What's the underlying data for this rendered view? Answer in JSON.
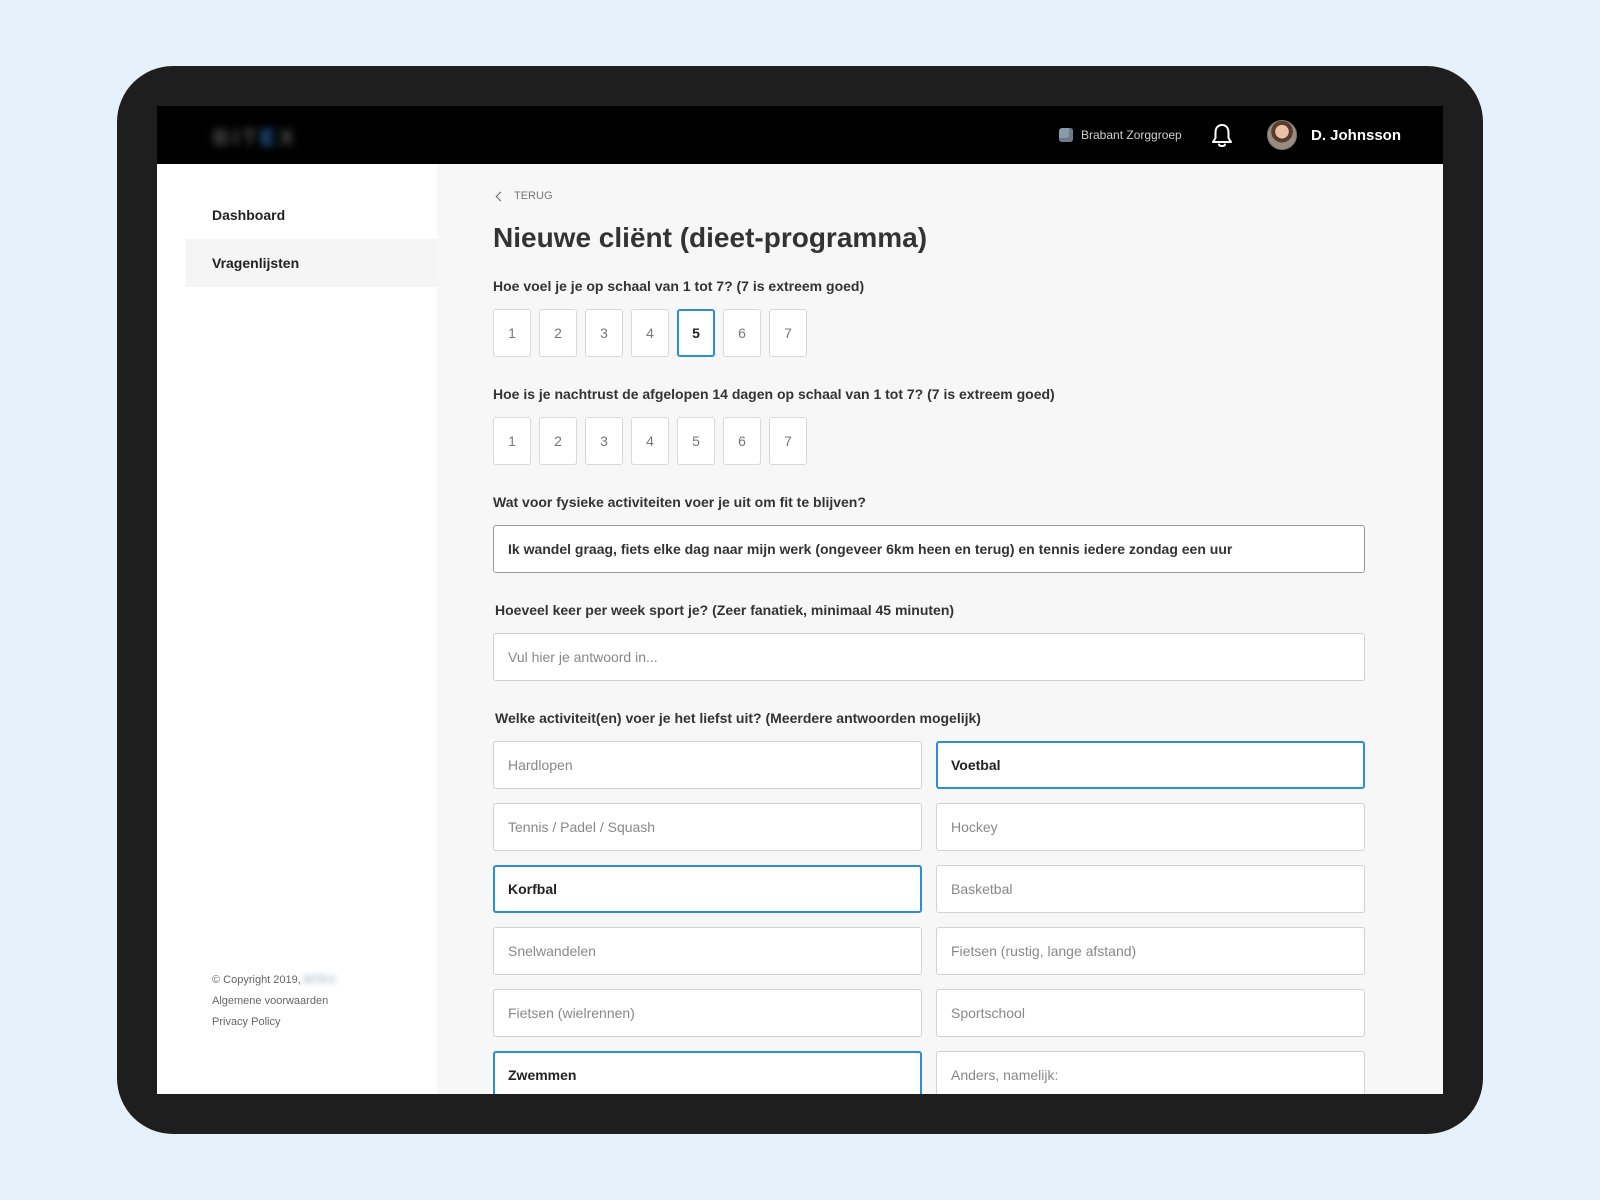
{
  "brand": {
    "logo_main": "BIT",
    "logo_accent": "E",
    "logo_tail": "X"
  },
  "header": {
    "organization": "Brabant Zorggroep",
    "user_name": "D. Johnsson"
  },
  "sidebar": {
    "items": [
      {
        "label": "Dashboard"
      },
      {
        "label": "Vragenlijsten"
      }
    ],
    "footer": {
      "copyright": "© Copyright 2019,",
      "company": "BITEX",
      "terms": "Algemene voorwaarden",
      "privacy": "Privacy Policy"
    }
  },
  "main": {
    "back_label": "TERUG",
    "title": "Nieuwe cliënt (dieet-programma)",
    "q1": {
      "label": "Hoe voel je je op schaal van 1 tot 7? (7 is extreem goed)",
      "options": [
        "1",
        "2",
        "3",
        "4",
        "5",
        "6",
        "7"
      ],
      "selected": "5"
    },
    "q2": {
      "label": "Hoe is je nachtrust de afgelopen 14 dagen op schaal van 1 tot 7? (7 is extreem goed)",
      "options": [
        "1",
        "2",
        "3",
        "4",
        "5",
        "6",
        "7"
      ]
    },
    "q3": {
      "label": "Wat voor fysieke activiteiten voer je uit om fit te blijven?",
      "value": "Ik wandel graag, fiets elke dag naar mijn werk (ongeveer 6km heen en terug) en tennis iedere zondag een uur"
    },
    "q4": {
      "label": "Hoeveel keer per week sport je? (Zeer fanatiek, minimaal 45 minuten)",
      "placeholder": "Vul hier je antwoord in..."
    },
    "q5": {
      "label": "Welke activiteit(en) voer je het liefst uit? (Meerdere antwoorden mogelijk)",
      "options": [
        {
          "label": "Hardlopen",
          "selected": false
        },
        {
          "label": "Voetbal",
          "selected": true
        },
        {
          "label": "Tennis / Padel / Squash",
          "selected": false
        },
        {
          "label": "Hockey",
          "selected": false
        },
        {
          "label": "Korfbal",
          "selected": true
        },
        {
          "label": "Basketbal",
          "selected": false
        },
        {
          "label": "Snelwandelen",
          "selected": false
        },
        {
          "label": "Fietsen (rustig, lange afstand)",
          "selected": false
        },
        {
          "label": "Fietsen (wielrennen)",
          "selected": false
        },
        {
          "label": "Sportschool",
          "selected": false
        },
        {
          "label": "Zwemmen",
          "selected": true
        },
        {
          "label": "Anders, namelijk:",
          "selected": false
        }
      ]
    }
  },
  "colors": {
    "accent": "#1e8fde",
    "topbar": "#000000",
    "frame": "#1e1e1e",
    "background": "#e6f2fb"
  },
  "icons": {
    "bell": "bell-icon",
    "back": "chevron-left-icon",
    "submit": "checkmark-icon"
  }
}
